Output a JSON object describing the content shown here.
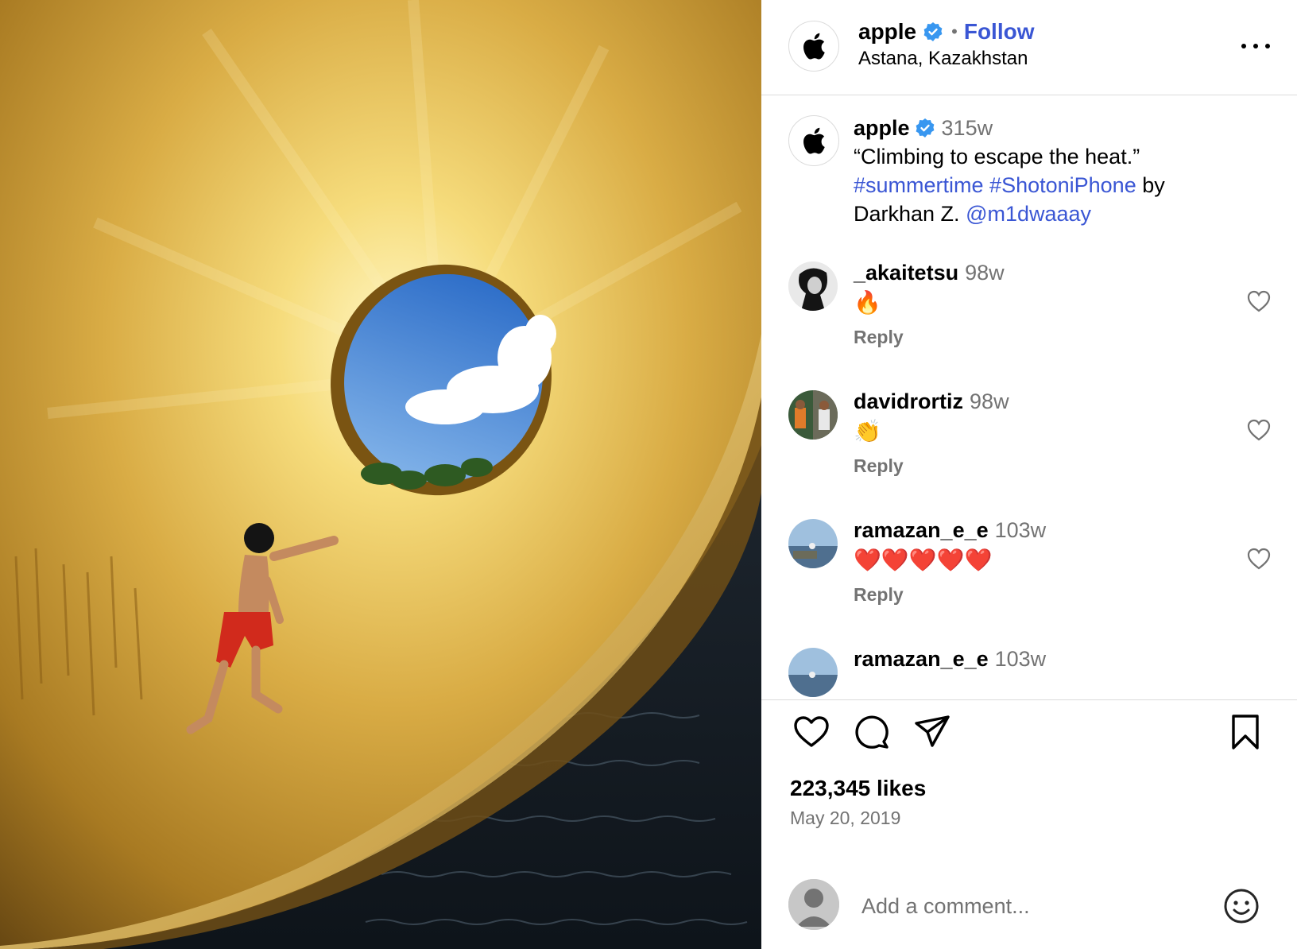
{
  "header": {
    "username": "apple",
    "follow_label": "Follow",
    "separator": "•",
    "location": "Astana, Kazakhstan",
    "more_icon": "ellipsis-icon"
  },
  "caption": {
    "username": "apple",
    "time": "315w",
    "text": "“Climbing to escape the heat.”",
    "hashtag1": "#summertime",
    "hashtag2": "#ShotoniPhone",
    "by": "by",
    "credit": "Darkhan Z.",
    "mention": "@m1dwaaay"
  },
  "comments": [
    {
      "username": "_akaitetsu",
      "time": "98w",
      "text": "🔥",
      "reply_label": "Reply"
    },
    {
      "username": "davidrortiz",
      "time": "98w",
      "text": "👏",
      "reply_label": "Reply"
    },
    {
      "username": "ramazan_e_e",
      "time": "103w",
      "text": "❤️❤️❤️❤️❤️",
      "reply_label": "Reply"
    },
    {
      "username": "ramazan_e_e",
      "time": "103w"
    }
  ],
  "actions": {
    "like_icon": "heart-icon",
    "comment_icon": "speech-bubble-icon",
    "share_icon": "paper-plane-icon",
    "save_icon": "bookmark-icon"
  },
  "likes": "223,345 likes",
  "date": "May 20, 2019",
  "add_comment": {
    "placeholder": "Add a comment..."
  },
  "colors": {
    "link": "#3a56d4",
    "verified": "#3897f0",
    "secondary": "#737373",
    "divider": "#dbdbdb"
  }
}
